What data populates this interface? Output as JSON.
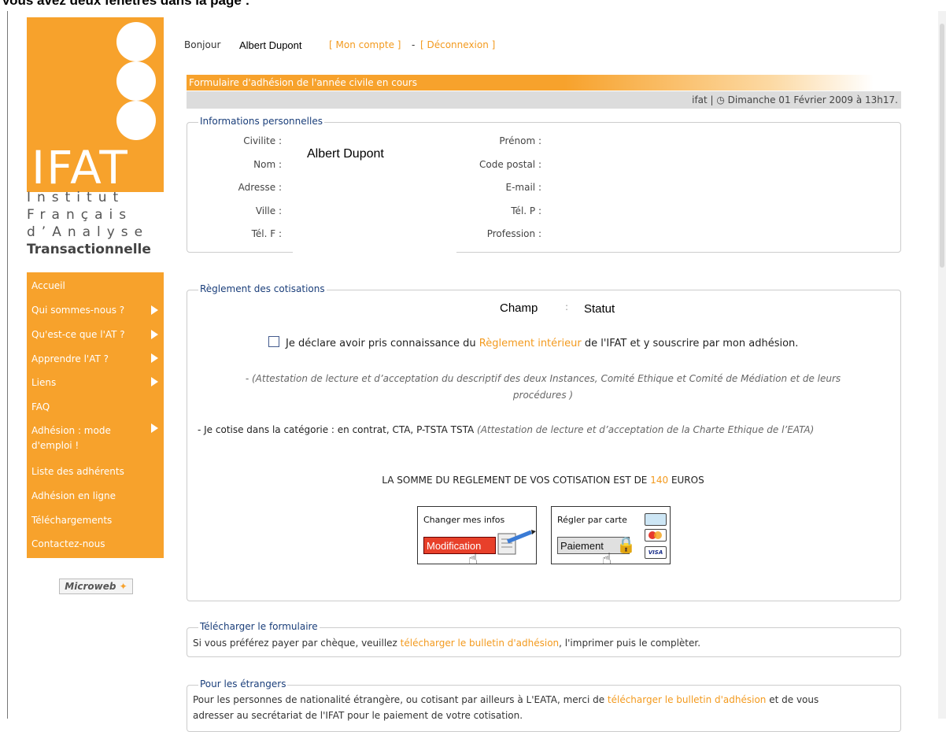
{
  "caption": "Vous avez deux fenêtres dans la page :",
  "logo": {
    "word": "IFAT",
    "tagline": [
      "Institut",
      "Français",
      "d’Analyse",
      "Transactionnelle"
    ]
  },
  "nav": {
    "items": [
      {
        "label": "Accueil",
        "arrow": false
      },
      {
        "label": "Qui sommes-nous ?",
        "arrow": true
      },
      {
        "label": "Qu'est-ce que l'AT ?",
        "arrow": true
      },
      {
        "label": "Apprendre l'AT ?",
        "arrow": true
      },
      {
        "label": "Liens",
        "arrow": true
      },
      {
        "label": "FAQ",
        "arrow": false
      },
      {
        "label": "Adhésion : mode",
        "arrow": true
      },
      {
        "label": "d'emploi !",
        "arrow": false
      },
      {
        "label": "Liste des adhérents",
        "arrow": false
      },
      {
        "label": "Adhésion en ligne",
        "arrow": false
      },
      {
        "label": "Téléchargements",
        "arrow": false
      },
      {
        "label": "Contactez-nous",
        "arrow": false
      }
    ]
  },
  "footer_badge": "Microweb",
  "header": {
    "greeting": "Bonjour",
    "user": "Albert Dupont",
    "account_link": "[ Mon compte ]",
    "separator": " - ",
    "logout_link": "[ Déconnexion ]",
    "page_title": "Formulaire d'adhésion de l'année civile en cours",
    "status_line": "ifat | ◷ Dimanche 01 Février 2009 à 13h17."
  },
  "personal": {
    "legend": "Informations personnelles",
    "left_labels": [
      "Civilite :",
      "Nom :",
      "Adresse :",
      "Ville :",
      "Tél. F :"
    ],
    "right_labels": [
      "Prénom :",
      "Code postal :",
      "E-mail :",
      "Tél. P :",
      "Profession :"
    ],
    "name_value": "Albert Dupont"
  },
  "payment": {
    "legend": "Règlement des cotisations",
    "col_field": "Champ",
    "col_colon": ":",
    "col_status": "Statut",
    "declare_pre": "Je déclare avoir pris connaissance du ",
    "declare_link": "Règlement intérieur",
    "declare_post": " de l'IFAT et y souscrire par mon adhésion.",
    "attestation_line1": "- (Attestation de lecture et d’acceptation du descriptif des deux Instances, Comité Ethique et Comité de Médiation et de leurs",
    "attestation_line2": "procédures )",
    "category_main": "- Je cotise dans la catégorie : en contrat, CTA, P-TSTA TSTA ",
    "category_italic": "(Attestation de lecture et d’acceptation de la Charte Ethique de l’EATA)",
    "sum_pre": "LA SOMME DU REGLEMENT DE VOS COTISATION EST DE ",
    "sum_value": "140",
    "sum_post": " EUROS",
    "change_caption": "Changer mes infos",
    "change_button": "Modification",
    "pay_caption": "Régler par carte",
    "pay_button": "Paiement",
    "visa": "VISA"
  },
  "download": {
    "legend": "Télécharger le formulaire",
    "pre": "Si vous préférez payer par chèque, veuillez ",
    "link": "télécharger le bulletin d'adhésion",
    "post": ", l'imprimer puis le complèter."
  },
  "foreign": {
    "legend": "Pour les étrangers",
    "pre": "Pour les personnes de nationalité étrangère, ou cotisant par ailleurs à L'EATA, merci de ",
    "link": "télécharger le bulletin d'adhésion",
    "post": " et de vous",
    "line2": "adresser au secrétariat de l'IFAT pour le paiement de votre cotisation."
  },
  "colors": {
    "accent": "#f7a22c",
    "link": "#f39a1e",
    "legend": "#1a3e7a"
  }
}
